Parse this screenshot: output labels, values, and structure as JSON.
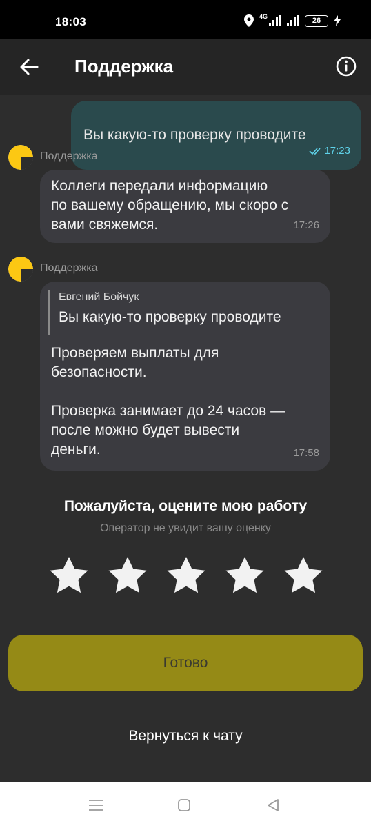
{
  "status_bar": {
    "time": "18:03",
    "network_label": "4G",
    "battery": "26",
    "icons": [
      "location-icon",
      "signal-icon",
      "signal-icon",
      "battery-icon",
      "charging-icon"
    ]
  },
  "header": {
    "title": "Поддержка",
    "back_icon": "arrow-left-icon",
    "info_icon": "info-icon"
  },
  "messages": [
    {
      "direction": "outgoing",
      "text": "Вы какую-то проверку проводите",
      "time": "17:23",
      "read_icon": "double-check-icon"
    },
    {
      "direction": "incoming",
      "sender": "Поддержка",
      "text": "Коллеги передали информацию\nпо вашему обращению, мы скоро с\nвами свяжемся.",
      "time": "17:26"
    },
    {
      "direction": "incoming",
      "sender": "Поддержка",
      "quote": {
        "author": "Евгений Бойчук",
        "text": "Вы какую-то проверку проводите"
      },
      "text": "Проверяем выплаты для\nбезопасности.\n\nПроверка занимает до 24 часов —\nпосле можно будет вывести\nденьги.",
      "time": "17:58"
    }
  ],
  "rating": {
    "title": "Пожалуйста, оцените мою работу",
    "subtitle": "Оператор не увидит вашу оценку",
    "stars_total": 5,
    "stars_selected": 0
  },
  "actions": {
    "done_label": "Готово",
    "back_to_chat_label": "Вернуться к чату"
  },
  "colors": {
    "background": "#2d2d2d",
    "outgoing_bubble": "#2a4a4d",
    "incoming_bubble": "#3b3b40",
    "accent_button": "#958a16",
    "read_ticks": "#5fd3ea",
    "avatar_yellow": "#fcc813"
  },
  "nav_bar": {
    "icons": [
      "menu-icon",
      "home-icon",
      "back-triangle-icon"
    ]
  }
}
